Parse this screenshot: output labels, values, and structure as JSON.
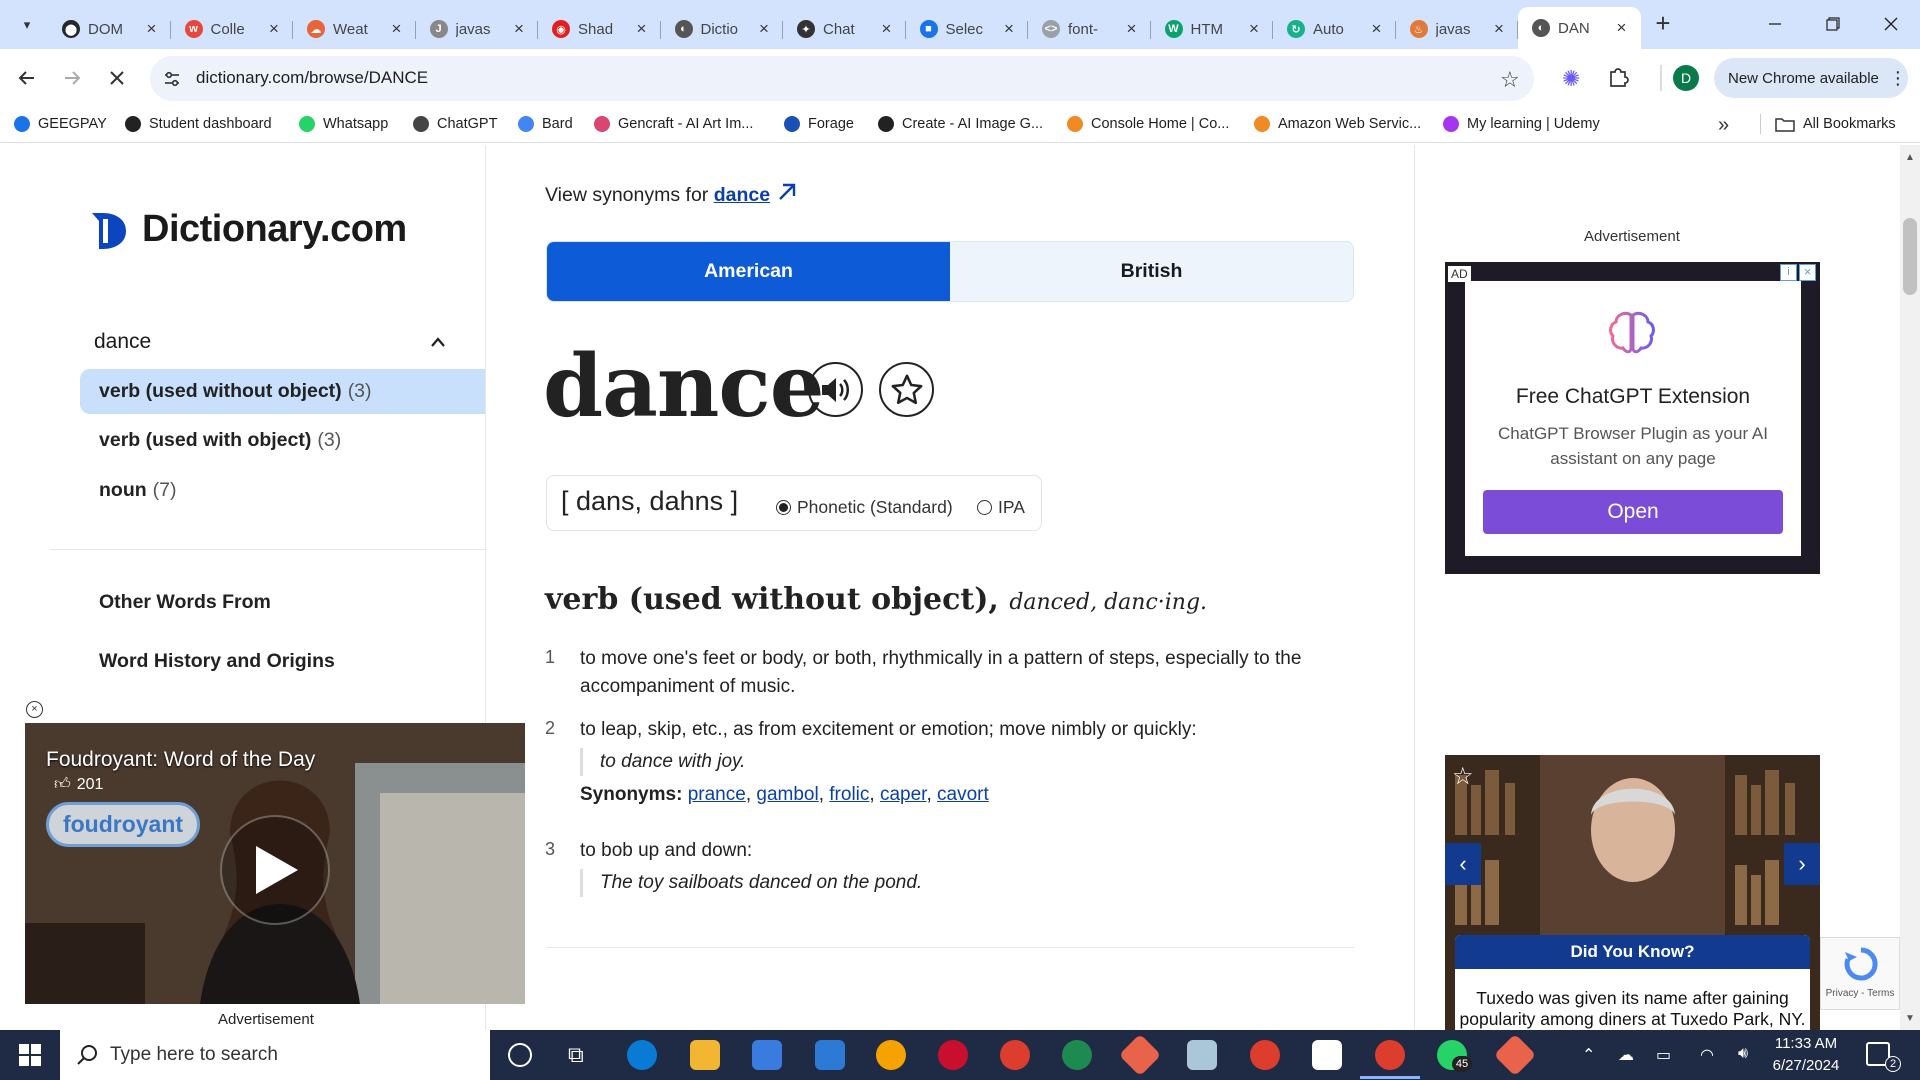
{
  "browser": {
    "tabs": [
      {
        "title": "DOM",
        "color": "#24292f",
        "glyph": "⬤"
      },
      {
        "title": "Colle",
        "color": "#e8473d",
        "glyph": "w"
      },
      {
        "title": "Weat",
        "color": "#e8643a",
        "glyph": "☁"
      },
      {
        "title": "javas",
        "color": "#888888",
        "glyph": "J"
      },
      {
        "title": "Shad",
        "color": "#e02020",
        "glyph": "◉"
      },
      {
        "title": "Dictio",
        "color": "#555555",
        "glyph": "◐"
      },
      {
        "title": "Chat",
        "color": "#333333",
        "glyph": "✦"
      },
      {
        "title": "Selec",
        "color": "#1a73e8",
        "glyph": "■"
      },
      {
        "title": "font-",
        "color": "#9aa0a6",
        "glyph": "<>"
      },
      {
        "title": "HTM",
        "color": "#0aa36b",
        "glyph": "W"
      },
      {
        "title": "Auto",
        "color": "#16b38a",
        "glyph": "↻"
      },
      {
        "title": "javas",
        "color": "#e07a3c",
        "glyph": "♨"
      },
      {
        "title": "DAN",
        "color": "#555555",
        "glyph": "◐"
      }
    ],
    "new_tab": "+",
    "url": "dictionary.com/browse/DANCE",
    "profile_initial": "D",
    "update_label": "New Chrome available",
    "bookmarks": [
      {
        "label": "GEEGPAY",
        "color": "#1a73e8"
      },
      {
        "label": "Student dashboard",
        "color": "#222222"
      },
      {
        "label": "Whatsapp",
        "color": "#25d366"
      },
      {
        "label": "ChatGPT",
        "color": "#444444"
      },
      {
        "label": "Bard",
        "color": "#4285f4"
      },
      {
        "label": "Gencraft - AI Art Im...",
        "color": "#d9466f"
      },
      {
        "label": "Forage",
        "color": "#1a4fb5"
      },
      {
        "label": "Create - AI Image G...",
        "color": "#222222"
      },
      {
        "label": "Console Home | Co...",
        "color": "#f08a24"
      },
      {
        "label": "Amazon Web Servic...",
        "color": "#f08a24"
      },
      {
        "label": "My learning | Udemy",
        "color": "#a435f0"
      }
    ],
    "bookmarks_more": "»",
    "all_bookmarks": "All Bookmarks"
  },
  "sidebar": {
    "logo": "Dictionary.com",
    "word": "dance",
    "items": [
      {
        "label": "verb (used without object)",
        "count": "(3)"
      },
      {
        "label": "verb (used with object)",
        "count": "(3)"
      },
      {
        "label": "noun",
        "count": "(7)"
      }
    ],
    "links": [
      "Other Words From",
      "Word History and Origins"
    ]
  },
  "entry": {
    "synonyms_prefix": "View synonyms for",
    "synonyms_word": "dance",
    "dialects": [
      "American",
      "British"
    ],
    "headword": "dance",
    "pronunciation": "[ dans, dahns ]",
    "pron_options": [
      "Phonetic (Standard)",
      "IPA"
    ],
    "pos": "verb (used without object),",
    "forms": "danced, danc·ing.",
    "definitions": [
      {
        "num": "1",
        "text": "to move one's feet or body, or both, rhythmically in a pattern of steps, especially to the accompaniment of music."
      },
      {
        "num": "2",
        "text": "to leap, skip, etc., as from excitement or emotion; move nimbly or quickly:",
        "example": "to dance with joy.",
        "synonyms_label": "Synonyms:",
        "synonyms": [
          "prance",
          "gambol",
          "frolic",
          "caper",
          "cavort"
        ]
      },
      {
        "num": "3",
        "text": "to bob up and down:",
        "example": "The toy sailboats danced on the pond."
      }
    ]
  },
  "ads": {
    "label": "Advertisement",
    "ad_badge": "AD",
    "ext_title": "Free ChatGPT Extension",
    "ext_desc": "ChatGPT Browser Plugin as your AI assistant on any page",
    "ext_button": "Open",
    "dyk_title": "Did You Know?",
    "dyk_text": "Tuxedo was given its name after gaining popularity among diners at Tuxedo Park, NY.",
    "recaptcha": "Privacy - Terms"
  },
  "video": {
    "title": "Foudroyant: Word of the Day",
    "likes": "201",
    "pill": "foudroyant",
    "ad_label": "Advertisement"
  },
  "taskbar": {
    "search_placeholder": "Type here to search",
    "time": "11:33 AM",
    "date": "6/27/2024",
    "whatsapp_badge": "45",
    "notifications": "2"
  }
}
